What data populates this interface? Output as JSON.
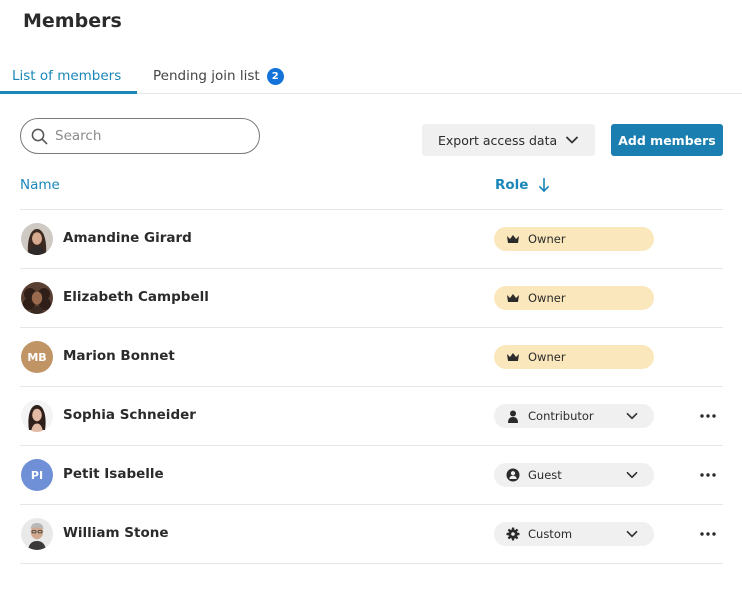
{
  "page": {
    "title": "Members"
  },
  "tabs": [
    {
      "label": "List of members",
      "active": true
    },
    {
      "label": "Pending join list",
      "badge": "2",
      "active": false
    }
  ],
  "search": {
    "placeholder": "Search",
    "value": ""
  },
  "toolbar": {
    "export_label": "Export access data",
    "add_label": "Add members"
  },
  "table": {
    "columns": {
      "name": "Name",
      "role": "Role",
      "role_sort": "descending"
    },
    "rows": [
      {
        "name": "Amandine Girard",
        "role": "Owner",
        "role_type": "owner",
        "avatar": "photo",
        "avatar_initials": "",
        "avatar_color": "#6b4a3a",
        "has_menu": false
      },
      {
        "name": "Elizabeth Campbell",
        "role": "Owner",
        "role_type": "owner",
        "avatar": "photo",
        "avatar_initials": "",
        "avatar_color": "#4a3428",
        "has_menu": false
      },
      {
        "name": "Marion Bonnet",
        "role": "Owner",
        "role_type": "owner",
        "avatar": "initials",
        "avatar_initials": "MB",
        "avatar_color": "#c09464",
        "has_menu": false
      },
      {
        "name": "Sophia Schneider",
        "role": "Contributor",
        "role_type": "select",
        "avatar": "photo",
        "avatar_initials": "",
        "avatar_color": "#3a2a24",
        "has_menu": true
      },
      {
        "name": "Petit Isabelle",
        "role": "Guest",
        "role_type": "select",
        "avatar": "initials",
        "avatar_initials": "PI",
        "avatar_color": "#6f8fd6",
        "has_menu": true
      },
      {
        "name": "William Stone",
        "role": "Custom",
        "role_type": "select",
        "avatar": "photo",
        "avatar_initials": "",
        "avatar_color": "#9a9a9a",
        "has_menu": true
      }
    ]
  },
  "colors": {
    "accent": "#1a87b8",
    "primary_button": "#1a7fb0",
    "owner_badge": "#fbe7bc",
    "select_bg": "#f0f0f0",
    "tab_badge": "#1473d8"
  },
  "icons": {
    "owner": "crown-icon",
    "contributor": "person-icon",
    "guest": "guest-icon",
    "custom": "gear-icon",
    "menu": "more-horizontal-icon",
    "search": "search-icon",
    "dropdown": "chevron-down-icon",
    "sort": "arrow-down-icon"
  }
}
